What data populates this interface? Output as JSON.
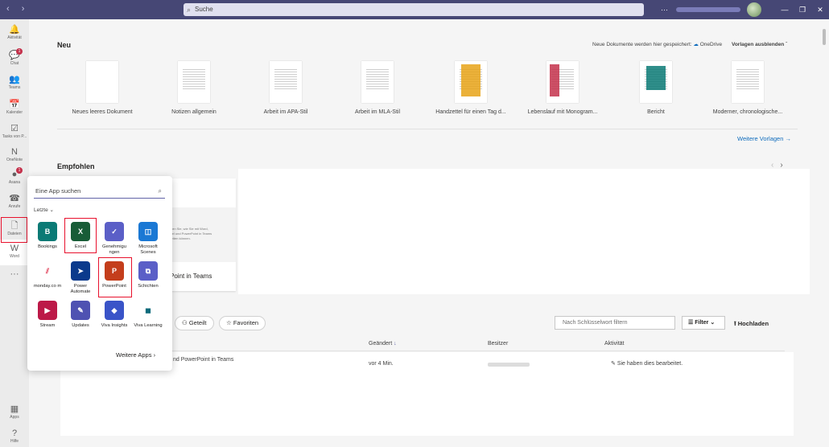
{
  "titlebar": {
    "nav": "‹ ›",
    "search_placeholder": "Suche",
    "more": "···",
    "minimize": "—",
    "restore": "❐",
    "close": "✕"
  },
  "rail": [
    {
      "label": "Aktivität",
      "glyph": "🔔",
      "top": 0
    },
    {
      "label": "Chat",
      "glyph": "💬",
      "badge": "1"
    },
    {
      "label": "Teams",
      "glyph": "👥"
    },
    {
      "label": "Kalender",
      "glyph": "📅"
    },
    {
      "label": "Tasks von P...",
      "glyph": "☑"
    },
    {
      "label": "OneNote",
      "glyph": "N"
    },
    {
      "label": "Asana",
      "glyph": "●",
      "badge": "1"
    },
    {
      "label": "Anrufe",
      "glyph": "☎"
    },
    {
      "label": "Dateien",
      "glyph": "🗋"
    },
    {
      "label": "Word",
      "glyph": "W"
    }
  ],
  "rail_more": "···",
  "rail_bottom": [
    {
      "label": "Apps",
      "glyph": "▦"
    },
    {
      "label": "Hilfe",
      "glyph": "?"
    }
  ],
  "neu": {
    "heading": "Neu",
    "save_info": "Neue Dokumente werden hier gespeichert:",
    "onedrive": "OneDrive",
    "hide_templates": "Vorlagen ausblenden",
    "templates": [
      "Neues leeres Dokument",
      "Notizen allgemein",
      "Arbeit im APA-Stil",
      "Arbeit im MLA-Stil",
      "Handzettel für einen Tag d...",
      "Lebenslauf mit Monogram...",
      "Bericht",
      "Moderner, chronologische..."
    ],
    "more_templates": "Weitere Vorlagen"
  },
  "empfohlen": {
    "heading": "Empfohlen",
    "card_title": "Point in Teams",
    "preview_text": "Sehen Sie, wie Sie mit Word, Excel und PowerPoint in Teams arbeiten können."
  },
  "files": {
    "tab_shared": "Geteilt",
    "tab_favorites": "Favoriten",
    "filter_placeholder": "Nach Schlüsselwort filtern",
    "filter_button": "Filter",
    "upload_button": "Hochladen",
    "columns": {
      "changed": "Geändert",
      "owner": "Besitzer",
      "activity": "Aktivität"
    },
    "rows": [
      {
        "name": "nd PowerPoint in Teams",
        "changed": "vor 4 Min.",
        "activity": "Sie haben dies bearbeitet."
      }
    ]
  },
  "flyout": {
    "search_placeholder": "Eine App suchen",
    "recent_label": "Letzte",
    "more_apps": "Weitere Apps",
    "apps": [
      {
        "label": "Bookings",
        "color": "#0b7a75",
        "glyph": "B"
      },
      {
        "label": "Excel",
        "color": "#185c37",
        "glyph": "X"
      },
      {
        "label": "Genehmigu ngen",
        "color": "#5b5fc7",
        "glyph": "✓"
      },
      {
        "label": "Microsoft Scenes",
        "color": "#1a78d4",
        "glyph": "◫"
      },
      {
        "label": "monday.co m",
        "color": "#ffffff",
        "glyph": "⫽"
      },
      {
        "label": "Power Automate",
        "color": "#0b3a8c",
        "glyph": "➤"
      },
      {
        "label": "PowerPoint",
        "color": "#c43e1c",
        "glyph": "P"
      },
      {
        "label": "Schichten",
        "color": "#5b5fc7",
        "glyph": "⧉"
      },
      {
        "label": "Stream",
        "color": "#bc1948",
        "glyph": "▶"
      },
      {
        "label": "Updates",
        "color": "#4f52b2",
        "glyph": "✎"
      },
      {
        "label": "Viva Insights",
        "color": "#3a54c8",
        "glyph": "◆"
      },
      {
        "label": "Viva Learning",
        "color": "#ffffff",
        "glyph": "◼"
      }
    ]
  },
  "colors": {
    "titlebar": "#464775",
    "accent": "#6264a7",
    "highlight": "#e8112d",
    "link": "#0f6cbd"
  }
}
